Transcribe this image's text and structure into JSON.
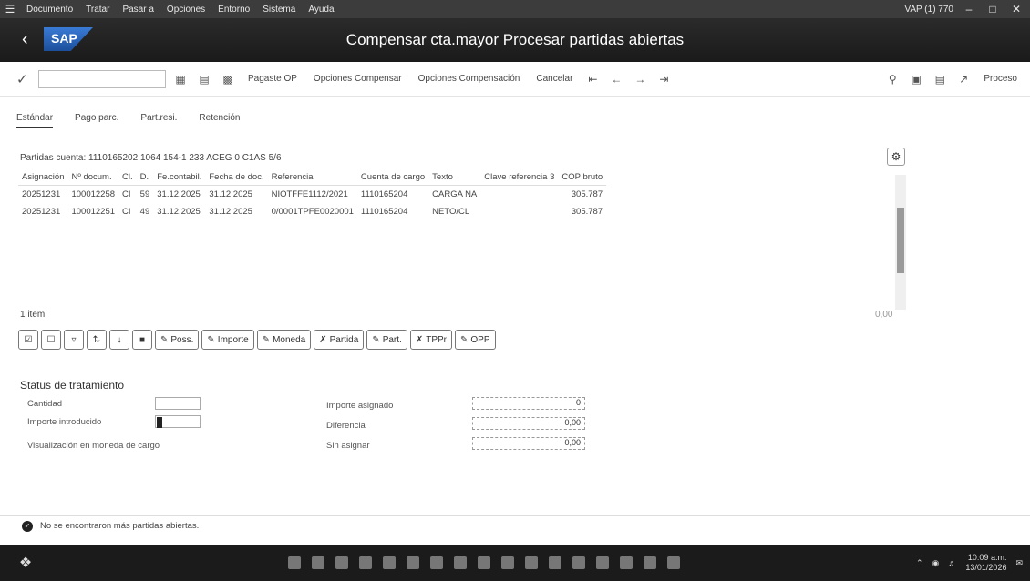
{
  "menubar": {
    "items": [
      "Documento",
      "Tratar",
      "Pasar a",
      "Opciones",
      "Entorno",
      "Sistema",
      "Ayuda"
    ],
    "system_info": "VAP (1) 770"
  },
  "titlebar": {
    "title": "Compensar cta.mayor Procesar partidas abiertas",
    "logo": "SAP"
  },
  "toolbar": {
    "buttons": [
      "Pagaste OP",
      "Opciones Compensar",
      "Opciones Compensación",
      "Cancelar"
    ],
    "right_button": "Proceso"
  },
  "tabs": [
    "Estándar",
    "Pago parc.",
    "Part.resi.",
    "Retención"
  ],
  "table": {
    "account_line": "Partidas cuenta: 1110165202 1064 154-1 233 ACEG 0 C1AS 5/6",
    "headers": [
      "Asignación",
      "Nº docum.",
      "Cl.",
      "D.",
      "Fe.contabil.",
      "Fecha de doc.",
      "Referencia",
      "Cuenta de cargo",
      "Texto",
      "Clave referencia 3",
      "COP bruto"
    ],
    "rows": [
      [
        "20251231",
        "100012258",
        "CI",
        "59",
        "31.12.2025",
        "31.12.2025",
        "NIOTFFE1112/2021",
        "1110165204",
        "CARGA NA",
        "",
        "305.787"
      ],
      [
        "20251231",
        "100012251",
        "CI",
        "49",
        "31.12.2025",
        "31.12.2025",
        "0/0001TPFE0020001",
        "1110165204",
        "NETO/CL",
        "",
        "305.787"
      ]
    ],
    "row_count": "1 item",
    "right_marker": "0,00"
  },
  "button_strip": {
    "labels": [
      "Poss.",
      "Importe",
      "Moneda",
      "Partida",
      "Part.",
      "TPPr",
      "OPP"
    ]
  },
  "status": {
    "title": "Status de tratamiento",
    "left_labels": [
      "Cantidad",
      "Importe introducido",
      "Visualización en moneda de cargo"
    ],
    "right_labels": [
      "Importe asignado",
      "Diferencia",
      "Sin asignar"
    ],
    "right_values": [
      "0",
      "0,00",
      "0,00"
    ]
  },
  "statusbar": {
    "message": "No se encontraron más partidas abiertas."
  },
  "taskbar": {
    "time": "10:09 a.m.",
    "date": "13/01/2026"
  }
}
